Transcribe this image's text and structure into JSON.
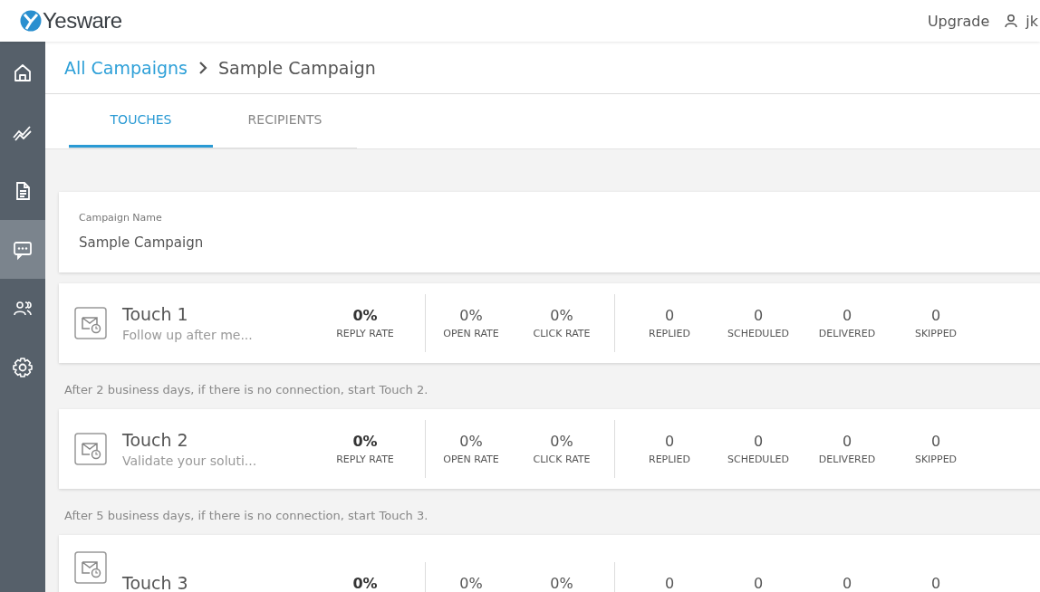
{
  "header": {
    "logo": "Yesware",
    "upgrade": "Upgrade",
    "user": "jk"
  },
  "sidebar": {
    "items": [
      {
        "kind": "home",
        "selected": false
      },
      {
        "kind": "chart",
        "selected": false
      },
      {
        "kind": "document",
        "selected": false
      },
      {
        "kind": "chat",
        "selected": true
      },
      {
        "kind": "people",
        "selected": false
      },
      {
        "kind": "settings",
        "selected": false
      }
    ]
  },
  "breadcrumb": {
    "parent": "All Campaigns",
    "current": "Sample Campaign"
  },
  "tabs": [
    {
      "label": "TOUCHES",
      "selected": true
    },
    {
      "label": "RECIPIENTS",
      "selected": false
    }
  ],
  "campaign": {
    "label": "Campaign Name",
    "value": "Sample Campaign"
  },
  "touches": [
    {
      "title": "Touch 1",
      "subtitle": "Follow up after me...",
      "metric_groups": [
        [
          {
            "value": "0%",
            "label": "REPLY RATE",
            "kind": "primary"
          }
        ],
        [
          {
            "value": "0%",
            "label": "OPEN RATE",
            "kind": "normal"
          },
          {
            "value": "0%",
            "label": "CLICK RATE",
            "kind": "normal"
          }
        ],
        [
          {
            "value": "0",
            "label": "REPLIED",
            "kind": "normal"
          },
          {
            "value": "0",
            "label": "SCHEDULED",
            "kind": "normal"
          },
          {
            "value": "0",
            "label": "DELIVERED",
            "kind": "normal"
          },
          {
            "value": "0",
            "label": "SKIPPED",
            "kind": "normal"
          }
        ]
      ],
      "note": "After 2 business days, if there is no connection, start Touch 2."
    },
    {
      "title": "Touch 2",
      "subtitle": "Validate your soluti...",
      "metric_groups": [
        [
          {
            "value": "0%",
            "label": "REPLY RATE",
            "kind": "primary"
          }
        ],
        [
          {
            "value": "0%",
            "label": "OPEN RATE",
            "kind": "normal"
          },
          {
            "value": "0%",
            "label": "CLICK RATE",
            "kind": "normal"
          }
        ],
        [
          {
            "value": "0",
            "label": "REPLIED",
            "kind": "normal"
          },
          {
            "value": "0",
            "label": "SCHEDULED",
            "kind": "normal"
          },
          {
            "value": "0",
            "label": "DELIVERED",
            "kind": "normal"
          },
          {
            "value": "0",
            "label": "SKIPPED",
            "kind": "normal"
          }
        ]
      ],
      "note": "After 5 business days, if there is no connection, start Touch 3."
    },
    {
      "title": "Touch 3",
      "metric_groups": [
        [
          {
            "value": "0%",
            "kind": "primary"
          }
        ],
        [
          {
            "value": "0%",
            "kind": "normal"
          },
          {
            "value": "0%",
            "kind": "normal"
          }
        ],
        [
          {
            "value": "0",
            "kind": "normal"
          },
          {
            "value": "0",
            "kind": "normal"
          },
          {
            "value": "0",
            "kind": "normal"
          },
          {
            "value": "0",
            "kind": "normal"
          }
        ]
      ]
    }
  ]
}
